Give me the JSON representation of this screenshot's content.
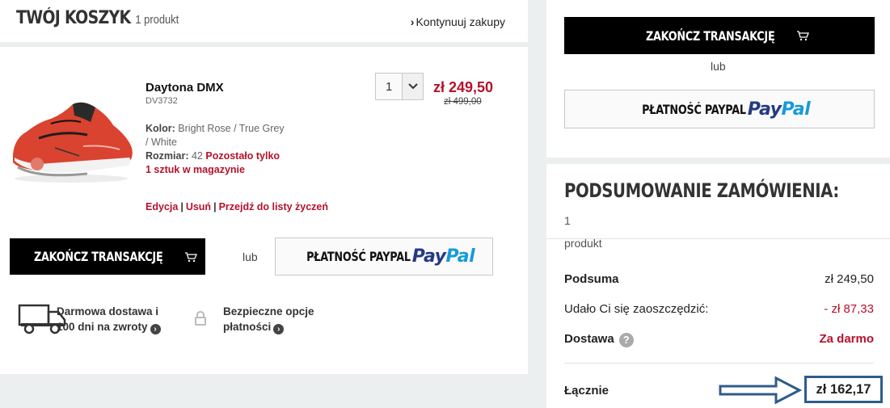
{
  "header": {
    "title": "TWÓJ KOSZYK",
    "count": "1 produkt",
    "continue_label": "Kontynuuj zakupy"
  },
  "product": {
    "name": "Daytona DMX",
    "sku": "DV3732",
    "color_label": "Kolor:",
    "color_value": "Bright Rose / True Grey / White",
    "size_label": "Rozmiar:",
    "size_value": "42",
    "stock_note": "Pozostało tylko 1 sztuk w magazynie",
    "quantity": "1",
    "price": "zł 249,50",
    "old_price": "zł 499,00",
    "actions": [
      "Edycja",
      "Usuń",
      "Przejdź do listy życzeń"
    ]
  },
  "buttons": {
    "checkout": "ZAKOŃCZ TRANSAKCJĘ",
    "or": "lub",
    "paypal_label": "PŁATNOŚĆ PAYPAL",
    "paypal_logo_1": "Pay",
    "paypal_logo_2": "Pal"
  },
  "perks": [
    {
      "text": "Darmowa dostawa i 100 dni na zwroty",
      "icon": "truck-icon"
    },
    {
      "text": "Bezpieczne opcje płatności",
      "icon": "lock-icon"
    }
  ],
  "summary": {
    "title": "PODSUMOWANIE ZAMÓWIENIA:",
    "count_num": "1",
    "count_word": "produkt",
    "subtotal_label": "Podsuma",
    "subtotal_value": "zł 249,50",
    "savings_label": "Udało Ci się zaoszczędzić:",
    "savings_value": "- zł 87,33",
    "shipping_label": "Dostawa",
    "shipping_value": "Za darmo",
    "total_label": "Łącznie",
    "total_value": "zł 162,17"
  },
  "colors": {
    "accent_red": "#b5122b",
    "highlight_blue": "#2f5c8a",
    "paypal_dark": "#253b80",
    "paypal_light": "#179bd7"
  }
}
